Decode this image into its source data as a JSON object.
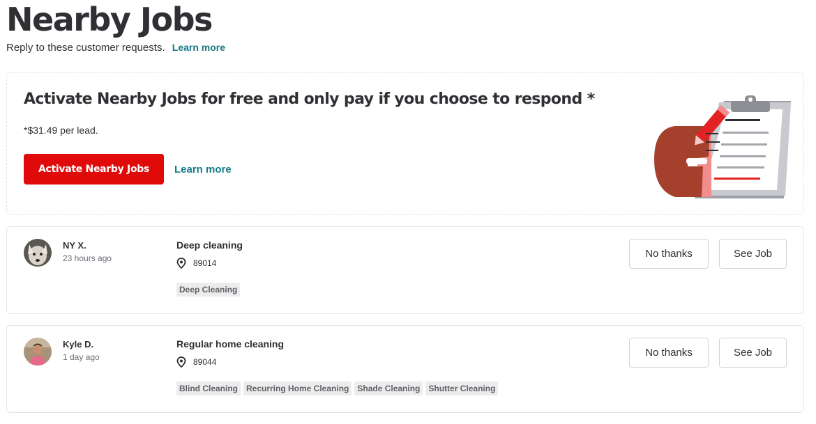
{
  "header": {
    "title": "Nearby Jobs",
    "subtitle": "Reply to these customer requests.",
    "learn_more": "Learn more"
  },
  "promo": {
    "heading": "Activate Nearby Jobs for free and only pay if you choose to respond *",
    "price_note": "*$31.49 per lead.",
    "activate_label": "Activate Nearby Jobs",
    "learn_more": "Learn more",
    "accent_color": "#e00a0a"
  },
  "jobs": [
    {
      "customer": "NY X.",
      "time": "23 hours ago",
      "title": "Deep cleaning",
      "zip": "89014",
      "tags": [
        "Deep Cleaning"
      ],
      "no_thanks": "No thanks",
      "see_job": "See Job"
    },
    {
      "customer": "Kyle D.",
      "time": "1 day ago",
      "title": "Regular home cleaning",
      "zip": "89044",
      "tags": [
        "Blind Cleaning",
        "Recurring Home Cleaning",
        "Shade Cleaning",
        "Shutter Cleaning"
      ],
      "no_thanks": "No thanks",
      "see_job": "See Job"
    }
  ]
}
